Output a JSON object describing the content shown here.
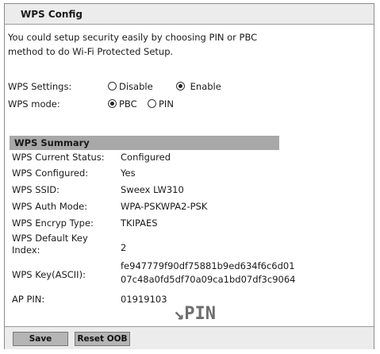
{
  "panel": {
    "title": "WPS Config"
  },
  "intro": "You could setup security easily by choosing PIN or PBC method to do Wi-Fi Protected Setup.",
  "settings": {
    "label": "WPS Settings:",
    "options": [
      {
        "label": "Disable",
        "checked": false
      },
      {
        "label": "Enable",
        "checked": true
      }
    ]
  },
  "mode": {
    "label": "WPS mode:",
    "options": [
      {
        "label": "PBC",
        "checked": true
      },
      {
        "label": "PIN",
        "checked": false
      }
    ]
  },
  "summary": {
    "title": "WPS Summary",
    "rows": [
      {
        "label": "WPS Current Status:",
        "value": "Configured"
      },
      {
        "label": "WPS Configured:",
        "value": "Yes"
      },
      {
        "label": "WPS SSID:",
        "value": "Sweex LW310"
      },
      {
        "label": "WPS Auth Mode:",
        "value": "WPA-PSKWPA2-PSK"
      },
      {
        "label": "WPS Encryp Type:",
        "value": "TKIPAES"
      },
      {
        "label": "WPS Default Key Index:",
        "value": "2"
      },
      {
        "label": "WPS Key(ASCII):",
        "value": "fe947779f90df75881b9ed634f6c6d01 07c48a0fd5df70a09ca1bd07df3c9064"
      },
      {
        "label": "AP PIN:",
        "value": "01919103"
      }
    ]
  },
  "annotation": {
    "arrow": "↘",
    "text": "PIN"
  },
  "footer": {
    "save_label": "Save",
    "reset_label": "Reset OOB"
  }
}
